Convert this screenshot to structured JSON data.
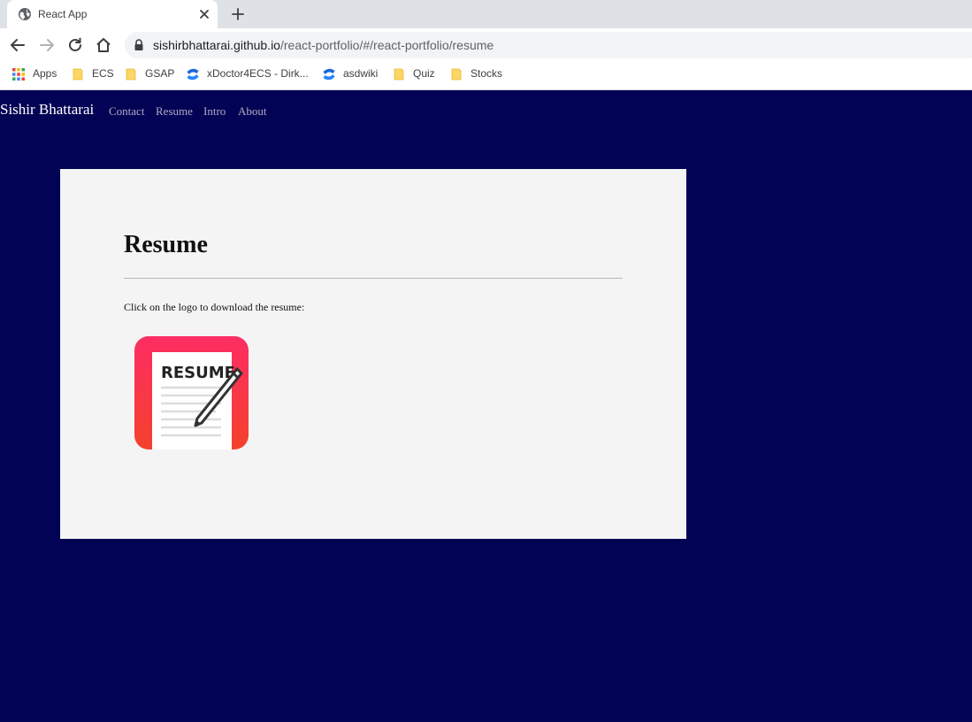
{
  "browser": {
    "tab": {
      "title": "React App",
      "favicon": "globe-icon"
    },
    "address": {
      "host": "sishirbhattarai.github.io",
      "path": "/react-portfolio/#/react-portfolio/resume"
    },
    "bookmarks": [
      {
        "label": "Apps",
        "icon": "apps-grid-icon"
      },
      {
        "label": "ECS",
        "icon": "folder-icon"
      },
      {
        "label": "GSAP",
        "icon": "folder-icon"
      },
      {
        "label": "xDoctor4ECS - Dirk...",
        "icon": "confluence-icon"
      },
      {
        "label": "asdwiki",
        "icon": "confluence-icon"
      },
      {
        "label": "Quiz",
        "icon": "folder-icon"
      },
      {
        "label": "Stocks",
        "icon": "folder-icon"
      }
    ]
  },
  "site": {
    "brand": "Sishir Bhattarai",
    "nav": [
      "Contact",
      "Resume",
      "Intro",
      "About"
    ]
  },
  "card": {
    "title": "Resume",
    "instruction": "Click on the logo to download the resume:",
    "logo_text": "RESUME"
  },
  "colors": {
    "page_bg": "#020354",
    "card_bg": "#f4f4f4",
    "nav_link": "#b4a9c9",
    "logo_gradient_top": "#fd2d64",
    "logo_gradient_bottom": "#f4412c"
  }
}
